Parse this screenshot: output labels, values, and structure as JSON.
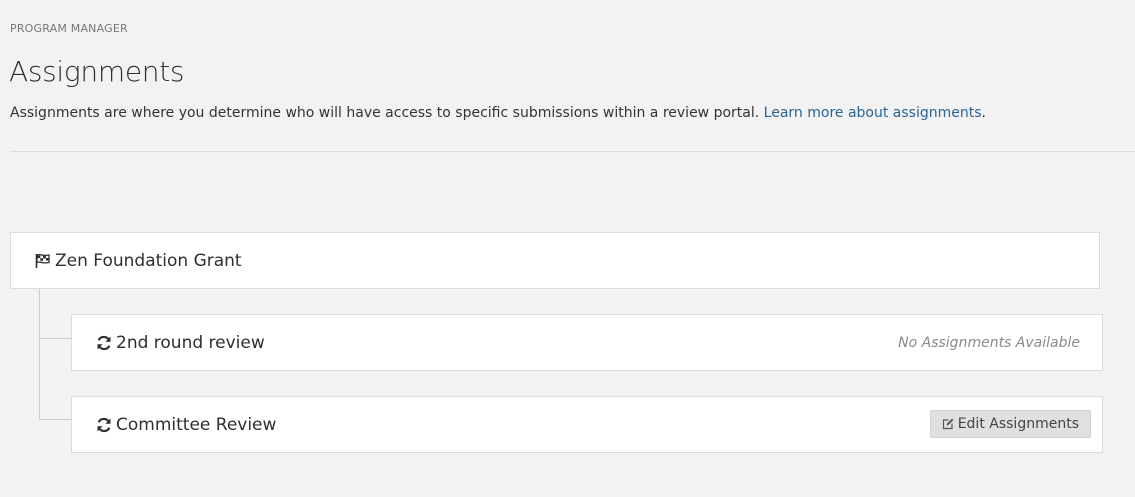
{
  "header": {
    "breadcrumb": "PROGRAM MANAGER",
    "title": "Assignments",
    "description_text": "Assignments are where you determine who will have access to specific submissions within a review portal. ",
    "learn_more_link": "Learn more about assignments",
    "description_end": "."
  },
  "program": {
    "name": "Zen Foundation Grant",
    "icon": "flag-checkered-icon"
  },
  "stages": [
    {
      "name": "2nd round review",
      "icon": "refresh-icon",
      "status": "No Assignments Available"
    },
    {
      "name": "Committee Review",
      "icon": "refresh-icon",
      "button_label": "Edit Assignments",
      "button_icon": "edit-icon"
    }
  ],
  "colors": {
    "background": "#f2f2f2",
    "link": "#2a6496",
    "button_bg": "#e0e0e0"
  }
}
